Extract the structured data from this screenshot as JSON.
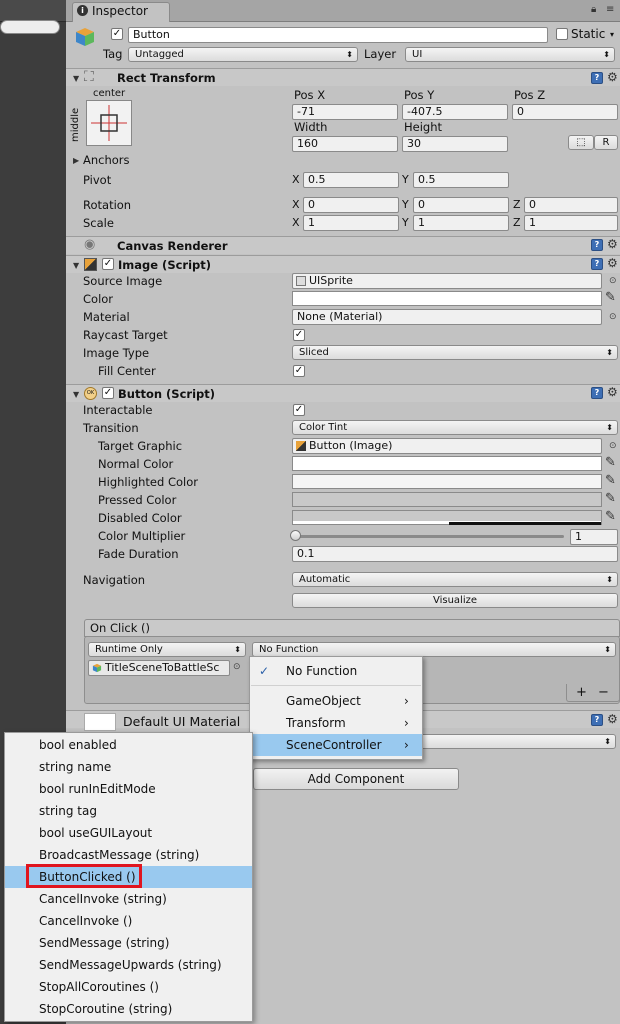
{
  "tab": {
    "title": "Inspector",
    "icon": "info-icon"
  },
  "gameobject": {
    "name": "Button",
    "active": true,
    "static_label": "Static",
    "static_checked": false,
    "tag_label": "Tag",
    "tag_value": "Untagged",
    "layer_label": "Layer",
    "layer_value": "UI"
  },
  "rect_transform": {
    "title": "Rect Transform",
    "anchor_preset_h": "center",
    "anchor_preset_v": "middle",
    "pos_x_label": "Pos X",
    "pos_y_label": "Pos Y",
    "pos_z_label": "Pos Z",
    "pos_x": "-71",
    "pos_y": "-407.5",
    "pos_z": "0",
    "width_label": "Width",
    "height_label": "Height",
    "width": "160",
    "height": "30",
    "r_button": "R",
    "anchors_label": "Anchors",
    "pivot_label": "Pivot",
    "pivot_x": "0.5",
    "pivot_y": "0.5",
    "rotation_label": "Rotation",
    "rot_x": "0",
    "rot_y": "0",
    "rot_z": "0",
    "scale_label": "Scale",
    "scale_x": "1",
    "scale_y": "1",
    "scale_z": "1",
    "x": "X",
    "y": "Y",
    "z": "Z"
  },
  "canvas_renderer": {
    "title": "Canvas Renderer"
  },
  "image": {
    "title": "Image (Script)",
    "source_image_label": "Source Image",
    "source_image": "UISprite",
    "color_label": "Color",
    "material_label": "Material",
    "material": "None (Material)",
    "raycast_label": "Raycast Target",
    "image_type_label": "Image Type",
    "image_type": "Sliced",
    "fill_center_label": "Fill Center"
  },
  "button": {
    "title": "Button (Script)",
    "interactable_label": "Interactable",
    "transition_label": "Transition",
    "transition": "Color Tint",
    "target_graphic_label": "Target Graphic",
    "target_graphic": "Button (Image)",
    "normal_color_label": "Normal Color",
    "highlighted_color_label": "Highlighted Color",
    "pressed_color_label": "Pressed Color",
    "disabled_color_label": "Disabled Color",
    "color_multiplier_label": "Color Multiplier",
    "color_multiplier": "1",
    "fade_duration_label": "Fade Duration",
    "fade_duration": "0.1",
    "navigation_label": "Navigation",
    "navigation": "Automatic",
    "visualize_label": "Visualize"
  },
  "onclick": {
    "title": "On Click ()",
    "runtime": "Runtime Only",
    "function": "No Function",
    "object": "TitleSceneToBattleSc",
    "plus": "+",
    "minus": "−"
  },
  "material_row": {
    "label": "Default UI Material"
  },
  "add_component": "Add Component",
  "popup_function": {
    "items": [
      {
        "label": "No Function",
        "checked": true
      },
      {
        "label": "GameObject",
        "submenu": true
      },
      {
        "label": "Transform",
        "submenu": true
      },
      {
        "label": "SceneController",
        "submenu": true,
        "highlighted": true
      }
    ]
  },
  "popup_methods": {
    "items": [
      "bool enabled",
      "string name",
      "bool runInEditMode",
      "string tag",
      "bool useGUILayout",
      "BroadcastMessage (string)",
      "ButtonClicked ()",
      "CancelInvoke (string)",
      "CancelInvoke ()",
      "SendMessage (string)",
      "SendMessageUpwards (string)",
      "StopAllCoroutines ()",
      "StopCoroutine (string)"
    ],
    "highlighted_index": 6
  },
  "colors": {
    "accent": "#99c9ef",
    "highlight_box": "#e0151f",
    "help_icon": "#3e6fb5"
  }
}
